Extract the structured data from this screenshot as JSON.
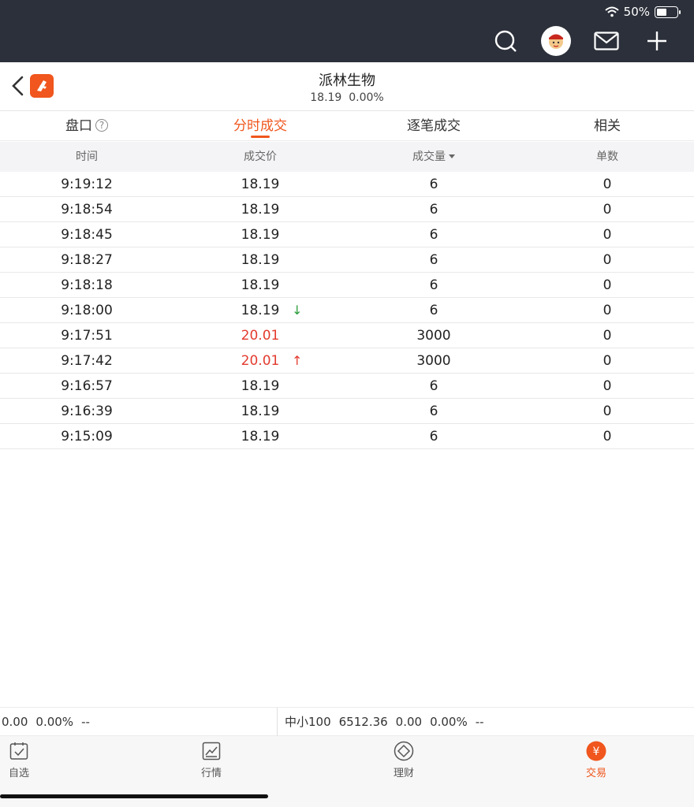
{
  "status": {
    "battery_text": "50%",
    "battery_level": 0.5
  },
  "header": {
    "stock_name": "派林生物",
    "price": "18.19",
    "change_pct": "0.00%"
  },
  "tabs": [
    {
      "label": "盘口",
      "help": "?"
    },
    {
      "label": "分时成交"
    },
    {
      "label": "逐笔成交"
    },
    {
      "label": "相关"
    }
  ],
  "columns": {
    "time": "时间",
    "price": "成交价",
    "volume": "成交量",
    "count": "单数"
  },
  "rows": [
    {
      "time": "9:19:12",
      "price": "18.19",
      "volume": "6",
      "count": "0",
      "arrow": ""
    },
    {
      "time": "9:18:54",
      "price": "18.19",
      "volume": "6",
      "count": "0",
      "arrow": ""
    },
    {
      "time": "9:18:45",
      "price": "18.19",
      "volume": "6",
      "count": "0",
      "arrow": ""
    },
    {
      "time": "9:18:27",
      "price": "18.19",
      "volume": "6",
      "count": "0",
      "arrow": ""
    },
    {
      "time": "9:18:18",
      "price": "18.19",
      "volume": "6",
      "count": "0",
      "arrow": ""
    },
    {
      "time": "9:18:00",
      "price": "18.19",
      "volume": "6",
      "count": "0",
      "arrow": "↓"
    },
    {
      "time": "9:17:51",
      "price": "20.01",
      "volume": "3000",
      "count": "0",
      "arrow": ""
    },
    {
      "time": "9:17:42",
      "price": "20.01",
      "volume": "3000",
      "count": "0",
      "arrow": "↑"
    },
    {
      "time": "9:16:57",
      "price": "18.19",
      "volume": "6",
      "count": "0",
      "arrow": ""
    },
    {
      "time": "9:16:39",
      "price": "18.19",
      "volume": "6",
      "count": "0",
      "arrow": ""
    },
    {
      "time": "9:15:09",
      "price": "18.19",
      "volume": "6",
      "count": "0",
      "arrow": ""
    }
  ],
  "colors": {
    "accent": "#f0561d",
    "up": "#e33b2e",
    "down": "#2a9d3a"
  },
  "ticker": {
    "left": {
      "value": "0.00",
      "pct": "0.00%",
      "dash": "--"
    },
    "right": {
      "name": "中小100",
      "value": "6512.36",
      "change": "0.00",
      "pct": "0.00%",
      "dash": "--"
    }
  },
  "nav": [
    {
      "label": "自选",
      "icon": "checkbox-icon"
    },
    {
      "label": "行情",
      "icon": "chart-icon"
    },
    {
      "label": "理财",
      "icon": "diamond-icon"
    },
    {
      "label": "交易",
      "icon": "yen-icon",
      "symbol": "¥"
    }
  ]
}
